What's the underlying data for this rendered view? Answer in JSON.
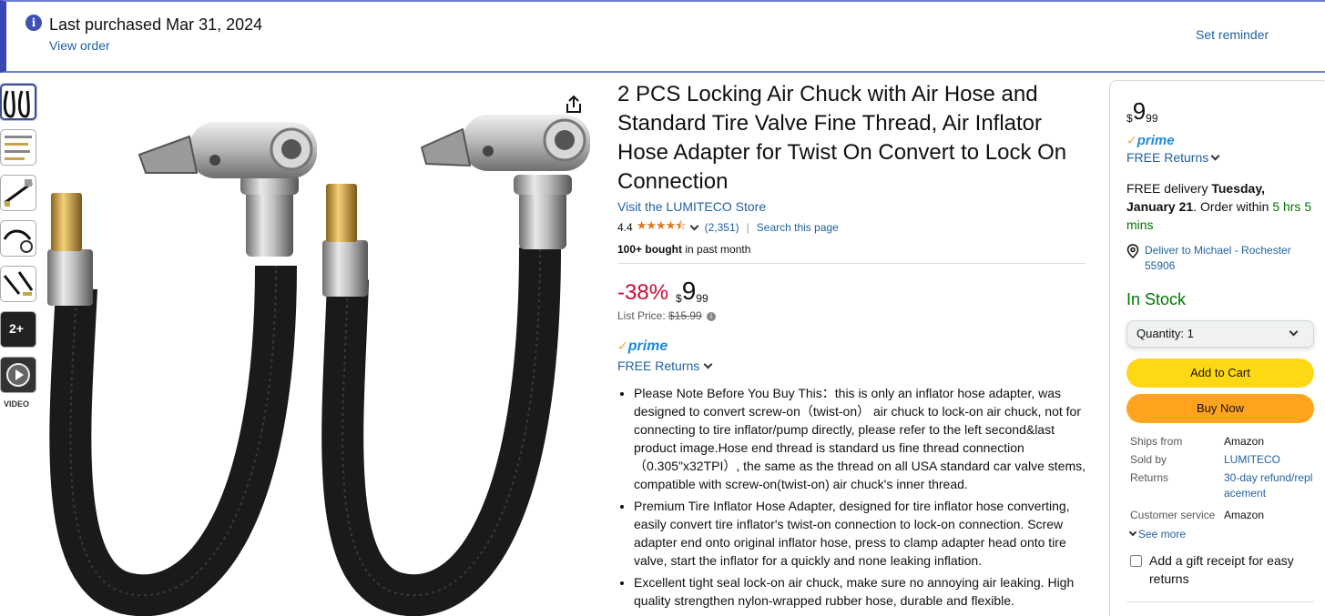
{
  "banner": {
    "title": "Last purchased Mar 31, 2024",
    "view_order": "View order",
    "set_reminder": "Set reminder",
    "icon": "info-icon"
  },
  "thumbnails": {
    "video_label": "VIDEO",
    "more_label": "2+"
  },
  "product": {
    "title": "2 PCS Locking Air Chuck with Air Hose and Standard Tire Valve Fine Thread, Air Inflator Hose Adapter for Twist On Convert to Lock On Connection",
    "store_link": "Visit the LUMITECO Store",
    "rating": "4.4",
    "stars": "★★★★⯪",
    "review_count": "(2,351)",
    "search_page": "Search this page",
    "bought_bold": "100+ bought",
    "bought_rest": "in past month"
  },
  "price": {
    "discount": "-38%",
    "currency": "$",
    "whole": "9",
    "fraction": "99",
    "list_label": "List Price:",
    "list_value": "$15.99",
    "prime_check": "✓",
    "prime_word": "prime",
    "returns": "FREE Returns"
  },
  "bullets": [
    "Please Note Before You Buy This：this is only an inflator hose adapter, was designed to convert screw-on（twist-on） air chuck to lock-on air chuck, not for connecting to tire inflator/pump directly, please refer to the left second&last product image.Hose end thread is standard us fine thread connection（0.305\"x32TPI）, the same as the thread on all USA standard car valve stems, compatible with screw-on(twist-on) air chuck's inner thread.",
    "Premium Tire Inflator Hose Adapter, designed for tire inflator hose converting, easily convert tire inflator's twist-on connection to lock-on connection. Screw adapter end onto original inflator hose, press to clamp adapter head onto tire valve, start the inflator for a quickly and none leaking inflation.",
    "Excellent tight seal lock-on air chuck, make sure no annoying air leaking. High quality strengthen nylon-wrapped rubber hose, durable and flexible."
  ],
  "buybox": {
    "currency": "$",
    "whole": "9",
    "fraction": "99",
    "prime_check": "✓",
    "prime_word": "prime",
    "returns": "FREE Returns",
    "delivery_prefix": "FREE delivery",
    "delivery_date": "Tuesday, January 21",
    "delivery_mid": ". Order within",
    "delivery_time": "5 hrs 5 mins",
    "deliver_to": "Deliver to Michael - Rochester 55906",
    "stock": "In Stock",
    "quantity_label": "Quantity:",
    "quantity_value": "1",
    "add_to_cart": "Add to Cart",
    "buy_now": "Buy Now",
    "ships_from_label": "Ships from",
    "ships_from_value": "Amazon",
    "sold_by_label": "Sold by",
    "sold_by_value": "LUMITECO",
    "returns_label": "Returns",
    "returns_value": "30-day refund/replacement",
    "customer_service_label": "Customer service",
    "customer_service_value": "Amazon",
    "see_more": "See more",
    "gift_receipt": "Add a gift receipt for easy returns"
  },
  "colors": {
    "link": "#2162a1",
    "discount": "#cc0c39",
    "in_stock": "#007600",
    "add_to_cart": "#ffd814",
    "buy_now": "#ffa41c",
    "prime": "#1b8be0",
    "star": "#de7921"
  }
}
